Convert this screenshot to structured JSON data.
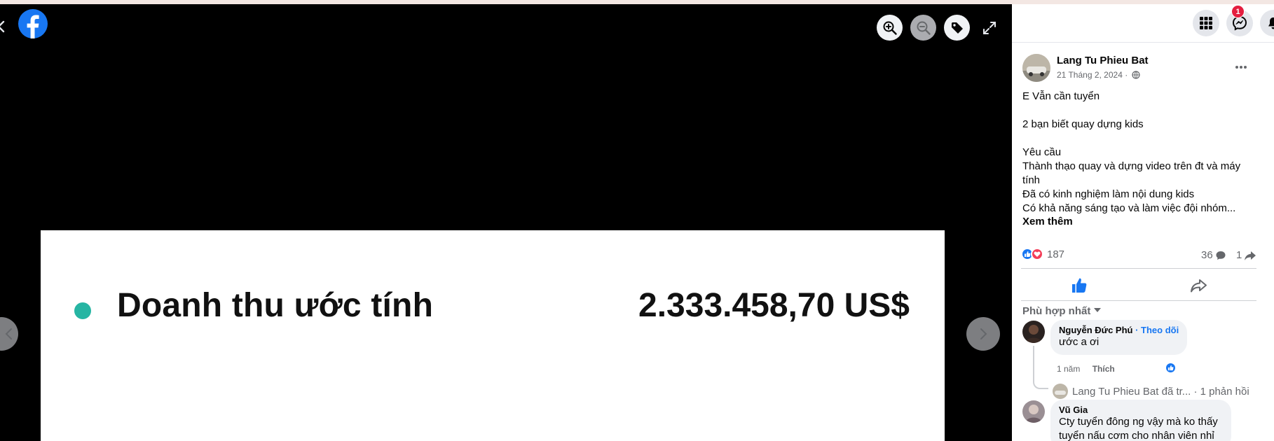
{
  "viewer": {
    "back_icon": "chevron-left-icon",
    "logo_icon": "facebook-logo",
    "controls": {
      "zoom_in_icon": "zoom-in-icon",
      "zoom_out_icon": "zoom-out-icon",
      "tag_icon": "tag-icon",
      "fullscreen_icon": "fullscreen-icon"
    },
    "photo": {
      "label": "Doanh thu ước tính",
      "amount": "2.333.458,70 US$",
      "dot_color": "#26b5a3"
    }
  },
  "topbar": {
    "menu_icon": "apps-grid-icon",
    "messenger_icon": "messenger-icon",
    "messenger_badge": "1",
    "notifications_icon": "bell-icon"
  },
  "post": {
    "author": "Lang Tu Phieu Bat",
    "date": "21 Tháng 2, 2024 ·",
    "lines": [
      "E Vẫn cần tuyển",
      "",
      "2 bạn biết quay dựng kids",
      "",
      "Yêu cầu",
      "Thành thạo quay và dựng video trên đt và máy",
      "tính",
      "Đã có kinh nghiệm làm nội dung kids",
      "Có khả năng sáng tạo và làm việc đội nhóm..."
    ],
    "see_more": "Xem thêm",
    "reaction_count": "187",
    "comment_count": "36",
    "share_count": "1",
    "like_color": "#1877f2",
    "love_color": "#f33e58"
  },
  "comments_section": {
    "sort_label": "Phù hợp nhất",
    "comments": [
      {
        "name": "Nguyễn Đức Phú",
        "follow": " · Theo dõi",
        "text": "ước a ơi",
        "time": "1 năm",
        "like_label": "Thích",
        "reply_summary": "Lang Tu Phieu Bat đã tr... · 1 phản hồi"
      },
      {
        "name": "Vũ Gia",
        "text_lines": [
          "Cty tuyển đông ng vậy mà ko thấy",
          "tuyển nấu cơm cho nhân viên nhỉ"
        ]
      }
    ]
  }
}
